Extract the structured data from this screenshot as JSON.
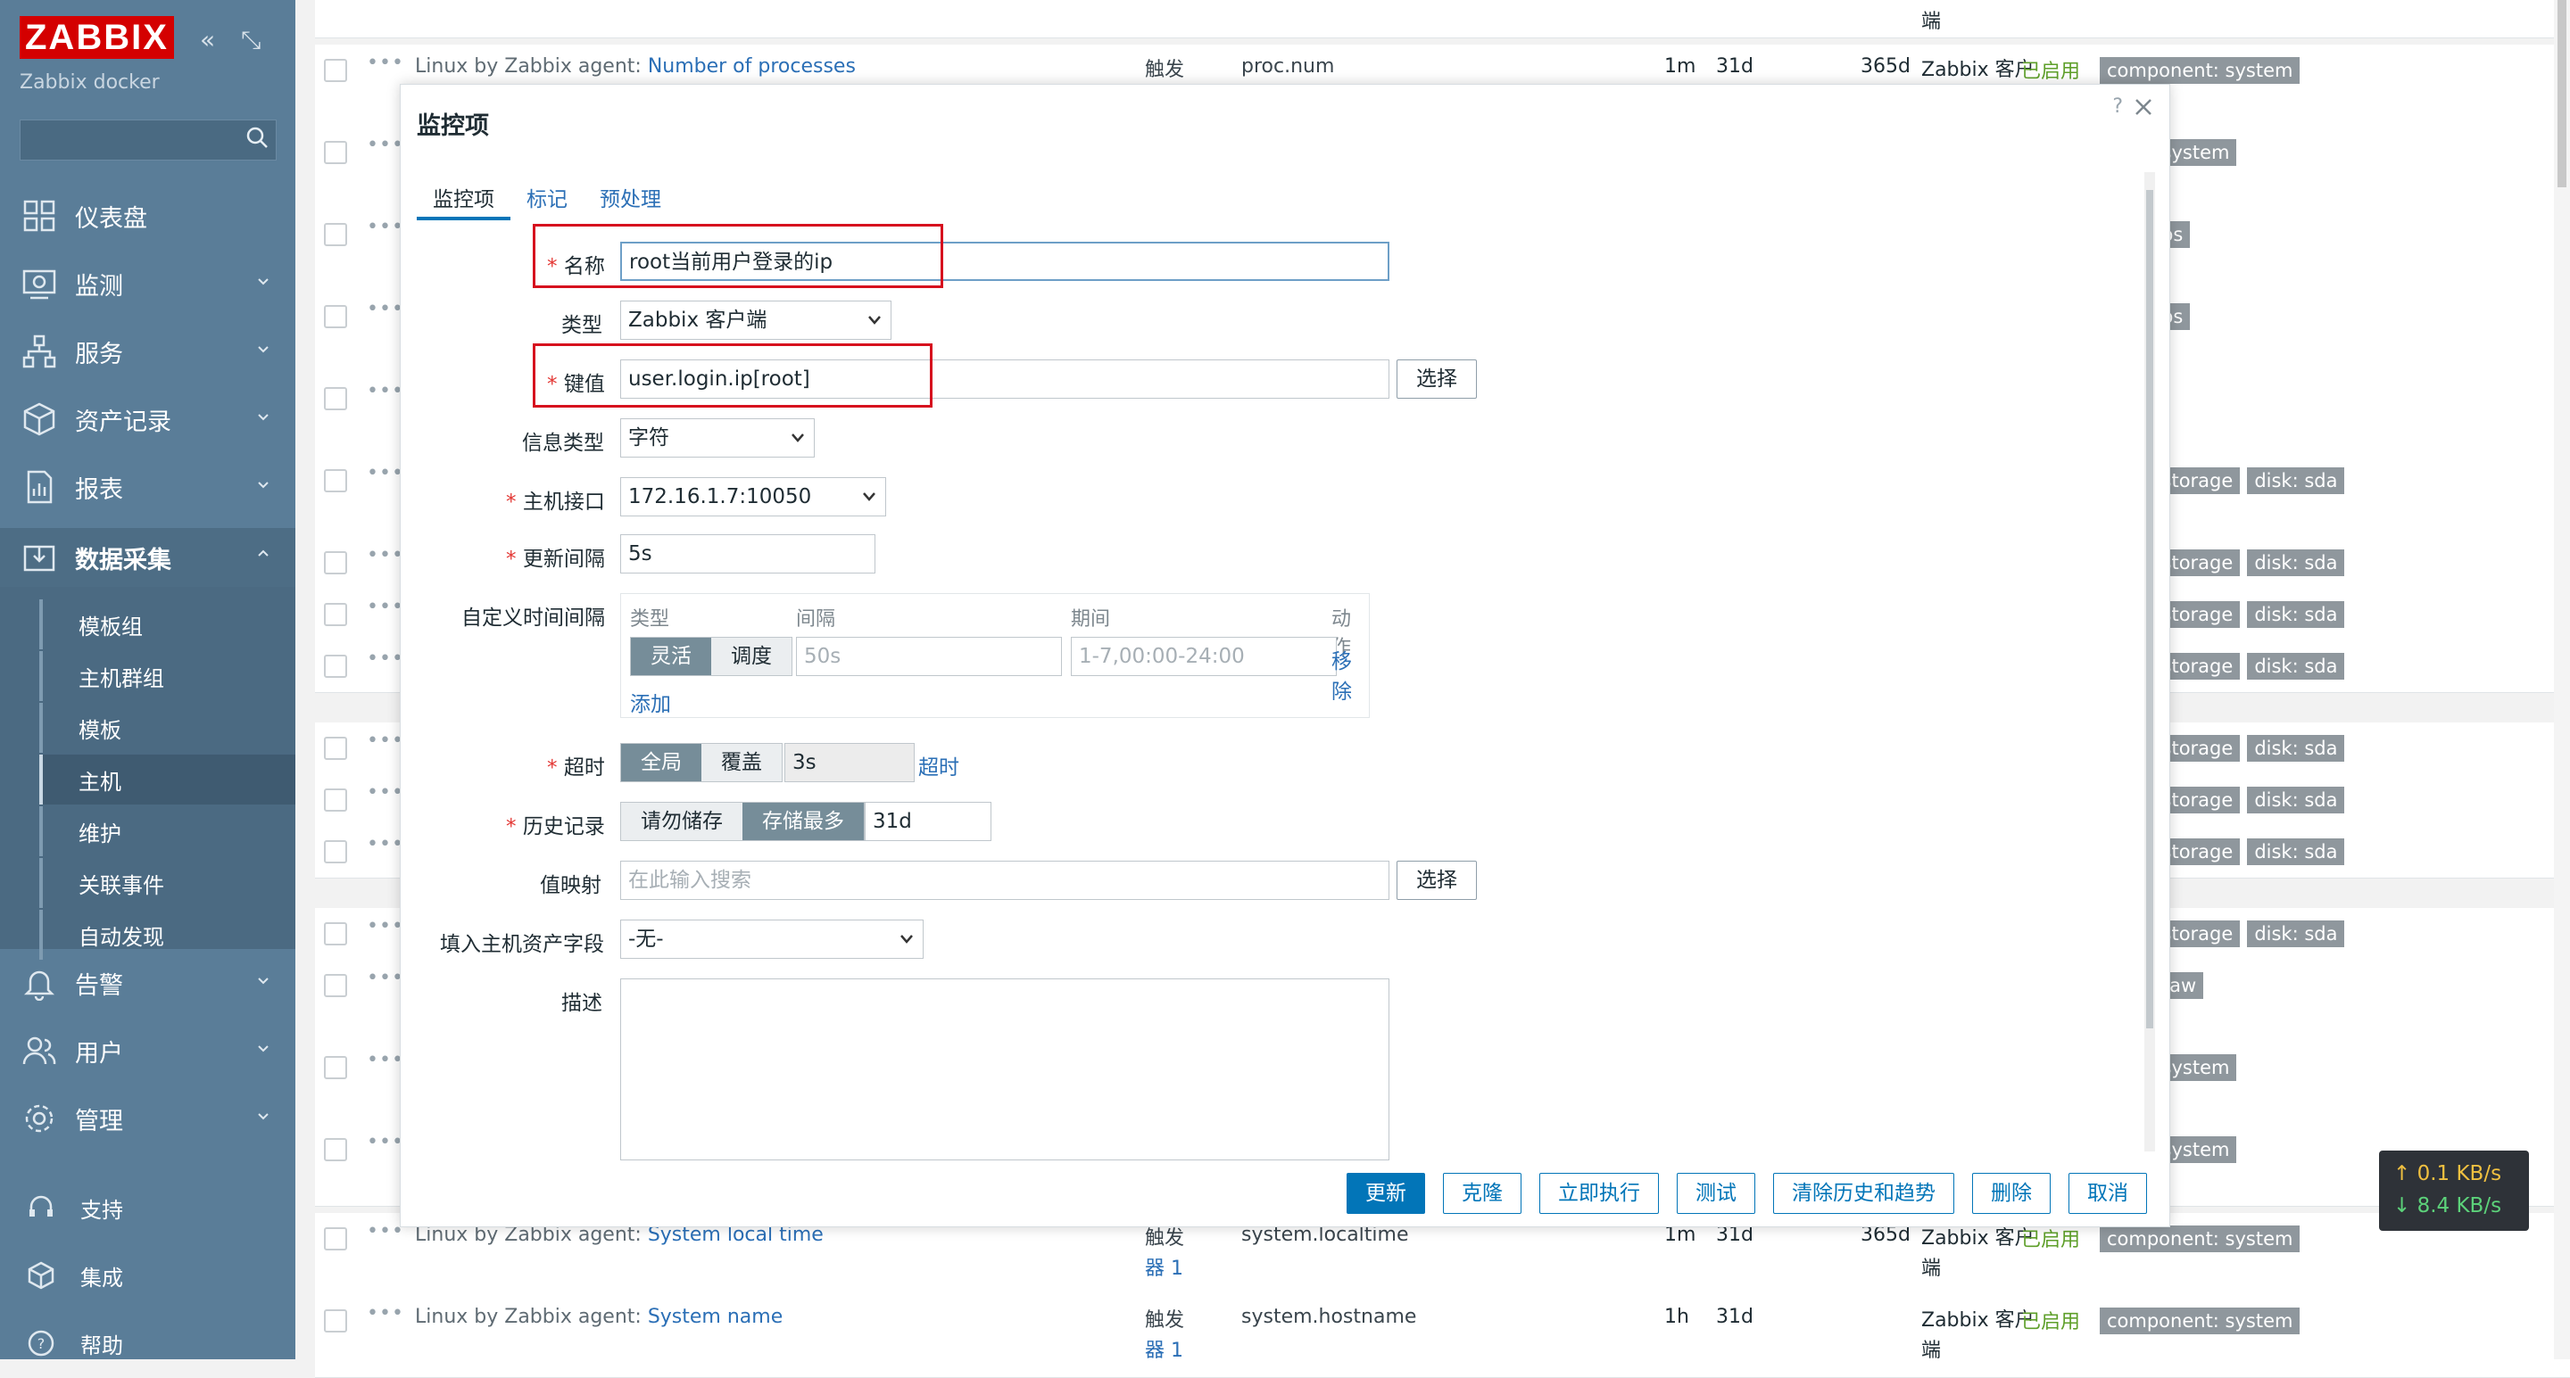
{
  "sidebar": {
    "logo": "ZABBIX",
    "subtitle": "Zabbix docker",
    "nav": [
      {
        "label": "仪表盘",
        "icon": "dashboard-icon"
      },
      {
        "label": "监测",
        "icon": "monitoring-icon"
      },
      {
        "label": "服务",
        "icon": "services-icon"
      },
      {
        "label": "资产记录",
        "icon": "inventory-icon"
      },
      {
        "label": "报表",
        "icon": "reports-icon"
      },
      {
        "label": "数据采集",
        "icon": "data-collection-icon"
      }
    ],
    "submenu": [
      "模板组",
      "主机群组",
      "模板",
      "主机",
      "维护",
      "关联事件",
      "自动发现"
    ],
    "nav2": [
      {
        "label": "告警",
        "icon": "alerts-icon"
      },
      {
        "label": "用户",
        "icon": "users-icon"
      },
      {
        "label": "管理",
        "icon": "administration-icon"
      }
    ],
    "footer": [
      {
        "label": "支持",
        "icon": "support-icon"
      },
      {
        "label": "集成",
        "icon": "integrations-icon"
      },
      {
        "label": "帮助",
        "icon": "help-icon"
      }
    ]
  },
  "list": {
    "row0": {
      "type_tail": "端"
    },
    "row1": {
      "prefix": "Linux by Zabbix agent: ",
      "name": "Number of processes",
      "trigger": "触发",
      "key": "proc.num",
      "interval": "1m",
      "history": "31d",
      "trends": "365d",
      "type": "Zabbix 客户",
      "status": "已启用",
      "tag": "component: system"
    },
    "row_tags": [
      [
        "nent: system"
      ],
      [
        "nent: os"
      ],
      [
        "nent: os"
      ],
      [],
      [
        "nent: storage",
        "disk: sda"
      ],
      [
        "nent: storage",
        "disk: sda"
      ],
      [
        "nent: storage",
        "disk: sda"
      ],
      [
        "nent: storage",
        "disk: sda"
      ],
      [
        "nent: storage",
        "disk: sda"
      ],
      [
        "nent: storage",
        "disk: sda"
      ],
      [
        "nent: storage",
        "disk: sda"
      ],
      [
        "nent: storage",
        "disk: sda"
      ],
      [
        "nent: raw"
      ],
      [
        "nent: system"
      ],
      [
        "nent: system"
      ]
    ],
    "row_last1": {
      "prefix": "Linux by Zabbix agent: ",
      "name": "System local time",
      "trigger": "触发",
      "trigger2": "器 1",
      "key": "system.localtime",
      "interval": "1m",
      "history": "31d",
      "trends": "365d",
      "type": "Zabbix 客户",
      "type2": "端",
      "status": "已启用",
      "tag": "component: system"
    },
    "row_last2": {
      "prefix": "Linux by Zabbix agent: ",
      "name": "System name",
      "trigger": "触发",
      "trigger2": "器 1",
      "key": "system.hostname",
      "interval": "1h",
      "history": "31d",
      "trends": "",
      "type": "Zabbix 客户",
      "type2": "端",
      "status": "已启用",
      "tag": "component: system"
    }
  },
  "modal": {
    "title": "监控项",
    "help": "?",
    "tabs": [
      "监控项",
      "标记",
      "预处理"
    ],
    "fields": {
      "name_label": "名称",
      "name_value": "root当前用户登录的ip",
      "type_label": "类型",
      "type_value": "Zabbix 客户端",
      "key_label": "键值",
      "key_value": "user.login.ip[root]",
      "key_select": "选择",
      "info_label": "信息类型",
      "info_value": "字符",
      "iface_label": "主机接口",
      "iface_value": "172.16.1.7:10050",
      "update_label": "更新间隔",
      "update_value": "5s",
      "custom_label": "自定义时间间隔",
      "custom_cols": [
        "类型",
        "间隔",
        "期间",
        "动作"
      ],
      "custom_seg": [
        "灵活",
        "调度"
      ],
      "custom_interval_ph": "50s",
      "custom_period_ph": "1-7,00:00-24:00",
      "custom_remove": "移除",
      "custom_add": "添加",
      "timeout_label": "超时",
      "timeout_seg": [
        "全局",
        "覆盖"
      ],
      "timeout_value": "3s",
      "timeout_link": "超时",
      "history_label": "历史记录",
      "history_seg": [
        "请勿储存",
        "存储最多"
      ],
      "history_value": "31d",
      "valuemap_label": "值映射",
      "valuemap_ph": "在此输入搜索",
      "valuemap_select": "选择",
      "inventory_label": "填入主机资产字段",
      "inventory_value": "-无-",
      "desc_label": "描述"
    },
    "buttons": [
      "更新",
      "克隆",
      "立即执行",
      "测试",
      "清除历史和趋势",
      "删除",
      "取消"
    ]
  },
  "speed": {
    "up": "↑ 0.1 KB/s",
    "down": "↓ 8.4 KB/s"
  }
}
